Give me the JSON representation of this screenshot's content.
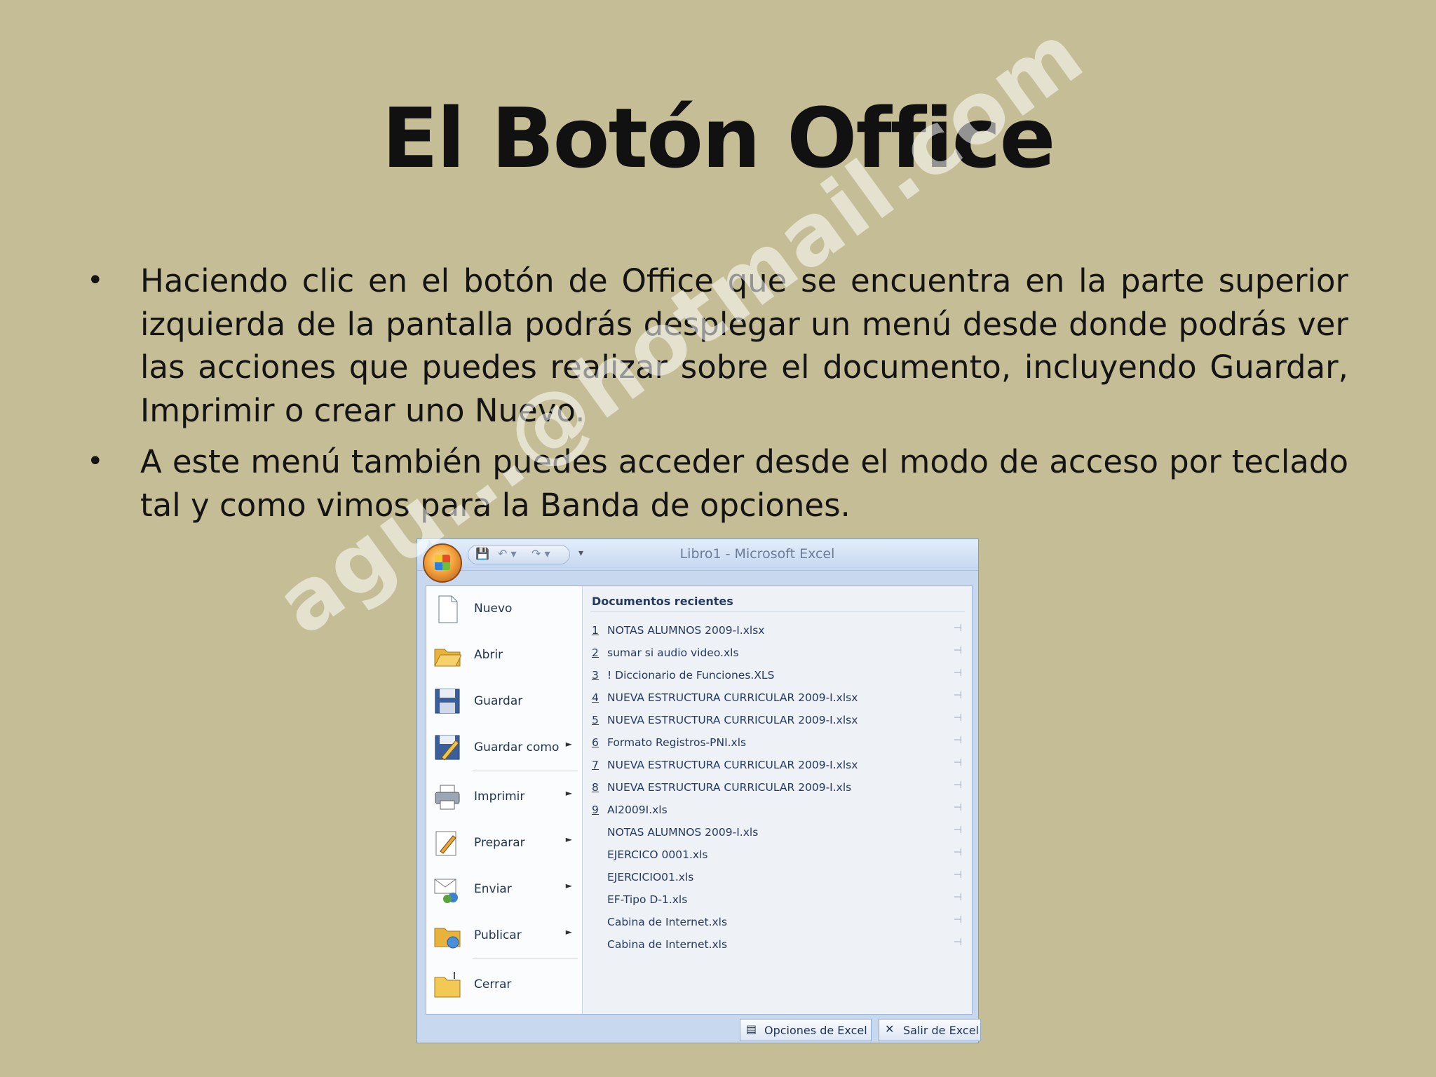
{
  "slide": {
    "title": "El Botón Office",
    "bullets": [
      "Haciendo clic en el botón de Office que se encuentra en la parte superior izquierda de la pantalla podrás desplegar un menú desde donde podrás ver las acciones que puedes realizar sobre el documento, incluyendo Guardar, Imprimir o crear uno Nuevo.",
      "A este menú también puedes acceder desde el modo de acceso por teclado tal y como vimos para la Banda de opciones."
    ],
    "bullet_char": "•",
    "watermark": "agu...@hotmail.com"
  },
  "excel": {
    "window_title": "Libro1 - Microsoft Excel",
    "qat": {
      "save": "💾",
      "undo": "↶ ▾",
      "redo": "↷ ▾",
      "more": "▾"
    },
    "menu_items": [
      {
        "label": "Nuevo",
        "icon": "new-document-icon",
        "glyph": "🗋",
        "arrow": ""
      },
      {
        "label": "Abrir",
        "icon": "open-folder-icon",
        "glyph": "📂",
        "arrow": ""
      },
      {
        "label": "Guardar",
        "icon": "save-disk-icon",
        "glyph": "💾",
        "arrow": ""
      },
      {
        "label": "Guardar como",
        "icon": "save-as-icon",
        "glyph": "🖫",
        "arrow": "►"
      },
      {
        "label": "Imprimir",
        "icon": "printer-icon",
        "glyph": "🖶",
        "arrow": "►"
      },
      {
        "label": "Preparar",
        "icon": "prepare-icon",
        "glyph": "✎",
        "arrow": "►"
      },
      {
        "label": "Enviar",
        "icon": "send-icon",
        "glyph": "✉",
        "arrow": "►"
      },
      {
        "label": "Publicar",
        "icon": "publish-icon",
        "glyph": "📁",
        "arrow": "►"
      },
      {
        "label": "Cerrar",
        "icon": "close-folder-icon",
        "glyph": "📁",
        "arrow": ""
      }
    ],
    "recent_header": "Documentos recientes",
    "recent": [
      {
        "num": "1",
        "name": "NOTAS ALUMNOS 2009-I.xlsx"
      },
      {
        "num": "2",
        "name": "sumar si audio video.xls"
      },
      {
        "num": "3",
        "name": "! Diccionario de Funciones.XLS"
      },
      {
        "num": "4",
        "name": "NUEVA ESTRUCTURA CURRICULAR 2009-I.xlsx"
      },
      {
        "num": "5",
        "name": "NUEVA ESTRUCTURA CURRICULAR 2009-I.xlsx"
      },
      {
        "num": "6",
        "name": "Formato Registros-PNI.xls"
      },
      {
        "num": "7",
        "name": "NUEVA ESTRUCTURA CURRICULAR 2009-I.xlsx"
      },
      {
        "num": "8",
        "name": "NUEVA ESTRUCTURA CURRICULAR 2009-I.xls"
      },
      {
        "num": "9",
        "name": "AI2009I.xls"
      },
      {
        "num": "",
        "name": "NOTAS ALUMNOS 2009-I.xls"
      },
      {
        "num": "",
        "name": "EJERCICO 0001.xls"
      },
      {
        "num": "",
        "name": "EJERCICIO01.xls"
      },
      {
        "num": "",
        "name": "EF-Tipo D-1.xls"
      },
      {
        "num": "",
        "name": "Cabina de Internet.xls"
      },
      {
        "num": "",
        "name": "Cabina de Internet.xls"
      }
    ],
    "pin_glyph": "⊣",
    "footer": {
      "options_label": "Opciones de Excel",
      "options_icon": "▤",
      "exit_label": "Salir de Excel",
      "exit_icon": "✕"
    }
  }
}
